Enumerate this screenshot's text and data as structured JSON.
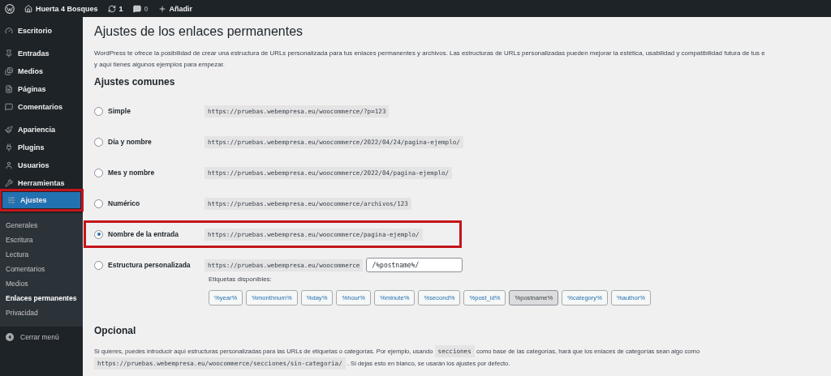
{
  "admin_bar": {
    "items": [
      {
        "kind": "logo"
      },
      {
        "kind": "site",
        "label": "Huerta 4 Bosques"
      },
      {
        "kind": "updates",
        "label": "1"
      },
      {
        "kind": "comments",
        "label": "0"
      },
      {
        "kind": "new",
        "label": "Añadir"
      }
    ]
  },
  "sidebar": {
    "menu_groups": [
      {
        "items": [
          {
            "label": "Escritorio",
            "selected": false,
            "highlighted": false
          }
        ]
      },
      {
        "items": [
          {
            "label": "Entradas",
            "selected": false,
            "highlighted": false
          },
          {
            "label": "Medios",
            "selected": false,
            "highlighted": false
          },
          {
            "label": "Páginas",
            "selected": false,
            "highlighted": false
          },
          {
            "label": "Comentarios",
            "selected": false,
            "highlighted": false
          }
        ]
      },
      {
        "items": [
          {
            "label": "Apariencia",
            "selected": false,
            "highlighted": false
          },
          {
            "label": "Plugins",
            "selected": false,
            "highlighted": false
          },
          {
            "label": "Usuarios",
            "selected": false,
            "highlighted": false
          },
          {
            "label": "Herramientas",
            "selected": false,
            "highlighted": false
          },
          {
            "label": "Ajustes",
            "selected": true,
            "highlighted": true
          }
        ]
      }
    ],
    "submenu": [
      {
        "label": "Generales",
        "selected": false
      },
      {
        "label": "Escritura",
        "selected": false
      },
      {
        "label": "Lectura",
        "selected": false
      },
      {
        "label": "Comentarios",
        "selected": false
      },
      {
        "label": "Medios",
        "selected": false
      },
      {
        "label": "Enlaces permanentes",
        "selected": true
      },
      {
        "label": "Privacidad",
        "selected": false
      }
    ],
    "collapse": {
      "label": "Cerrar menú"
    }
  },
  "page": {
    "title": "Ajustes de los enlaces permanentes",
    "intro": [
      "WordPress te ofrece la posibilidad de crear una estructura de URLs personalizada para tus enlaces permanentes y archivos. Las estructuras de URLs personalizadas pueden mejorar la estética, usabilidad y compatibilidad futura de tus e",
      "y aquí tienes algunos ejemplos para empezar."
    ],
    "common_heading": "Ajustes comunes",
    "options": [
      {
        "label": "Simple",
        "example": "https://pruebas.webempresa.eu/woocommerce/?p=123",
        "selected": false,
        "highlighted": false
      },
      {
        "label": "Día y nombre",
        "example": "https://pruebas.webempresa.eu/woocommerce/2022/04/24/pagina-ejemplo/",
        "selected": false,
        "highlighted": false
      },
      {
        "label": "Mes y nombre",
        "example": "https://pruebas.webempresa.eu/woocommerce/2022/04/pagina-ejemplo/",
        "selected": false,
        "highlighted": false
      },
      {
        "label": "Numérico",
        "example": "https://pruebas.webempresa.eu/woocommerce/archivos/123",
        "selected": false,
        "highlighted": false
      },
      {
        "label": "Nombre de la entrada",
        "example": "https://pruebas.webempresa.eu/woocommerce/pagina-ejemplo/",
        "selected": true,
        "highlighted": true
      }
    ],
    "custom": {
      "label": "Estructura personalizada",
      "selected": false,
      "prefix": "https://pruebas.webempresa.eu/woocommerce",
      "value": "/%postname%/",
      "tags_label": "Etiquetas disponibles:",
      "tags": [
        {
          "label": "%year%",
          "selected": false
        },
        {
          "label": "%monthnum%",
          "selected": false
        },
        {
          "label": "%day%",
          "selected": false
        },
        {
          "label": "%hour%",
          "selected": false
        },
        {
          "label": "%minute%",
          "selected": false
        },
        {
          "label": "%second%",
          "selected": false
        },
        {
          "label": "%post_id%",
          "selected": false
        },
        {
          "label": "%postname%",
          "selected": true
        },
        {
          "label": "%category%",
          "selected": false
        },
        {
          "label": "%author%",
          "selected": false
        }
      ]
    },
    "optional": {
      "heading": "Opcional",
      "text_before": "Si quieres, puedes introducir aquí estructuras personalizadas para las URLs de etiquetas o categorías. Por ejemplo, usando",
      "code": "secciones",
      "text_after": "como base de las categorías, hará que los enlaces de categorías sean algo como",
      "example": "https://pruebas.webempresa.eu/woocommerce/secciones/sin-categoria/",
      "text_end": ". Si dejas esto en blanco, se usarán los ajustes por defecto."
    }
  }
}
